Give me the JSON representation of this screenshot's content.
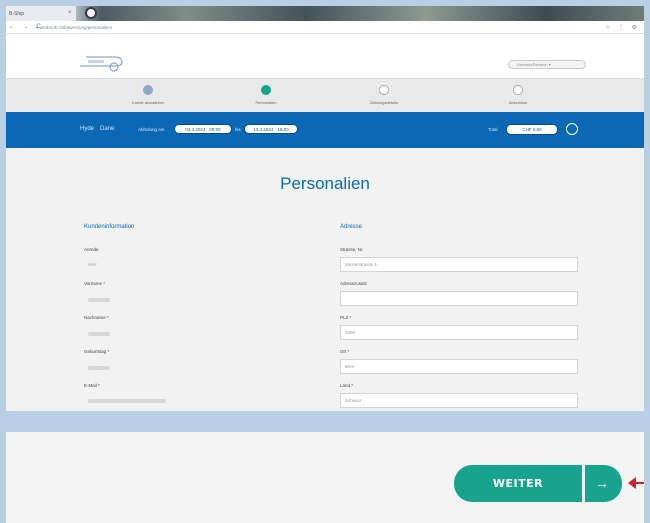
{
  "browser": {
    "tab_title": "B-Ship",
    "tab_close_glyph": "×",
    "nav_glyphs": "← → C",
    "url": "● jarsbook.ch/bewerbung/personalien/",
    "toolbar_glyphs": "☆ ⋮ ⚙"
  },
  "header": {
    "language_selector": "Deutsch/Deutsch ▾"
  },
  "stepper": {
    "steps": [
      {
        "label": "Kunde auswählen",
        "state": "done"
      },
      {
        "label": "Personalien",
        "state": "active"
      },
      {
        "label": "Zahlungsdetails",
        "state": "pending"
      },
      {
        "label": "Abschluss",
        "state": "pending"
      }
    ]
  },
  "booking_bar": {
    "boat": "Hyde",
    "type": "Dane",
    "from_label": "Abholung am",
    "from_value": "03.4.2024 · 09:00",
    "to_label": "bis",
    "to_value": "13.4.2024 · 18:00",
    "total_label": "Total",
    "total_value": "CHF 0.00"
  },
  "page": {
    "title": "Personalien",
    "left_section_title": "Kundeninformation",
    "right_section_title": "Adresse",
    "left_fields": [
      {
        "label": "Anrede",
        "value": "Herr"
      },
      {
        "label": "Vorname *",
        "value": ""
      },
      {
        "label": "Nachname *",
        "value": ""
      },
      {
        "label": "Geburtstag *",
        "value": ""
      },
      {
        "label": "E-Mail *",
        "value": ""
      }
    ],
    "right_fields": [
      {
        "label": "Strasse, Nr.",
        "value": "Musterstrasse 1"
      },
      {
        "label": "Adresszusatz",
        "value": ""
      },
      {
        "label": "PLZ *",
        "value": "1000"
      },
      {
        "label": "Ort *",
        "value": "Bern"
      },
      {
        "label": "Land *",
        "value": "Schweiz"
      }
    ]
  },
  "footer_action": {
    "next_label": "WEITER",
    "next_icon": "arrow-right-icon",
    "next_glyph": "→"
  },
  "colors": {
    "brand_blue": "#0a68b4",
    "accent_green": "#17a38d",
    "annotation_red": "#d3202a"
  }
}
